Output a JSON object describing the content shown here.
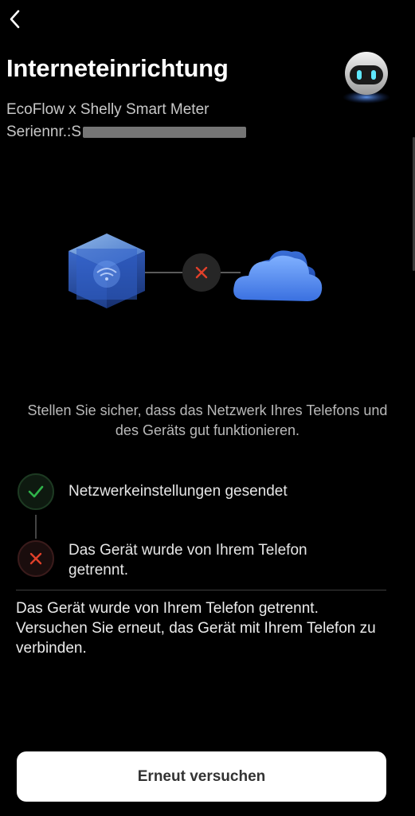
{
  "header": {
    "back_icon": "chevron-left-icon",
    "title": "Interneteinrichtung",
    "mascot_icon": "robot-assistant-icon"
  },
  "device": {
    "name": "EcoFlow x Shelly Smart Meter",
    "serial_label": "Seriennr.:S"
  },
  "illustration": {
    "device_icon": "wifi-cube-icon",
    "status_icon": "close-icon",
    "cloud_icon": "cloud-icon"
  },
  "hint": "Stellen Sie sicher, dass das Netzwerk Ihres Telefons und des Geräts gut funktionieren.",
  "steps": [
    {
      "label": "Netzwerkeinstellungen gesendet",
      "status": "success",
      "icon": "checkmark-icon"
    },
    {
      "label": "Das Gerät wurde von Ihrem Telefon getrennt.",
      "status": "error",
      "icon": "close-icon"
    }
  ],
  "error_message": "Das Gerät wurde von Ihrem Telefon getrennt. Versuchen Sie erneut, das Gerät mit Ihrem Telefon zu verbinden.",
  "retry_label": "Erneut versuchen",
  "colors": {
    "background": "#000000",
    "success": "#2fb34a",
    "error": "#e0402a",
    "cloud": "#4a86e8",
    "button_bg": "#ffffff"
  }
}
